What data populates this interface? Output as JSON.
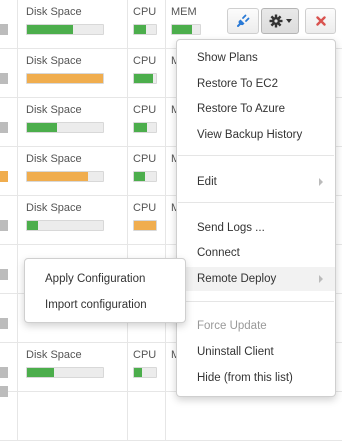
{
  "columns": {
    "disk": "Disk Space",
    "cpu": "CPU",
    "mem": "MEM",
    "mem_cut": "M"
  },
  "colors": {
    "green": "#4cae4c",
    "orange": "#f0ad4e",
    "track": "#ececec"
  },
  "rows": [
    {
      "disk_fill": 0.6,
      "disk_color": "green",
      "cpu_fill": 0.55,
      "cpu_color": "green",
      "mem_fill": 0.7,
      "mem_color": "green"
    },
    {
      "disk_fill": 1.0,
      "disk_color": "orange",
      "cpu_fill": 0.85,
      "cpu_color": "green"
    },
    {
      "disk_fill": 0.4,
      "disk_color": "green",
      "cpu_fill": 0.6,
      "cpu_color": "green"
    },
    {
      "disk_fill": 0.8,
      "disk_color": "orange",
      "cpu_fill": 0.5,
      "cpu_color": "green"
    },
    {
      "disk_fill": 0.15,
      "disk_color": "green",
      "cpu_fill": 1.0,
      "cpu_color": "orange"
    },
    {},
    {},
    {
      "disk_fill": 0.35,
      "disk_color": "green",
      "cpu_fill": 0.35,
      "cpu_color": "green"
    },
    {}
  ],
  "toolbar": {
    "connect_icon": "plug-icon",
    "settings_icon": "gear-icon",
    "dropdown_icon": "caret-down-icon",
    "remove_icon": "close-icon"
  },
  "main_menu": {
    "items": [
      {
        "label": "Show Plans"
      },
      {
        "label": "Restore To EC2"
      },
      {
        "label": "Restore To Azure"
      },
      {
        "label": "View Backup History"
      },
      {
        "label": "Edit"
      },
      {
        "label": "Send Logs ..."
      },
      {
        "label": "Connect"
      },
      {
        "label": "Remote Deploy"
      },
      {
        "label": "Force Update"
      },
      {
        "label": "Uninstall Client"
      },
      {
        "label": "Hide (from this list)"
      }
    ]
  },
  "submenu": {
    "items": [
      {
        "label": "Apply Configuration"
      },
      {
        "label": "Import configuration"
      }
    ]
  }
}
